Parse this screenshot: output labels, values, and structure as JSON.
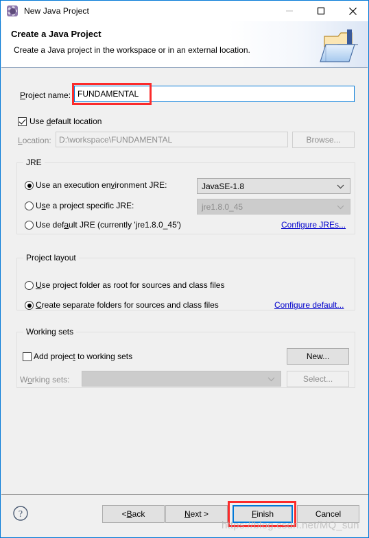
{
  "window": {
    "title": "New Java Project",
    "icon": "java-project-gear-icon",
    "controls": {
      "minimize": "minimize-icon",
      "maximize": "maximize-icon",
      "close": "close-icon"
    },
    "border_color": "#0078d7"
  },
  "header": {
    "title": "Create a Java Project",
    "subtitle": "Create a Java project in the workspace or in an external location.",
    "icon": "java-folder-icon"
  },
  "form": {
    "project_name_label": "Project name:",
    "project_name_value": "FUNDAMENTAL",
    "use_default_location_label": "Use default location",
    "use_default_location_checked": true,
    "location_label": "Location:",
    "location_value": "D:\\workspace\\FUNDAMENTAL",
    "browse_label": "Browse...",
    "browse_enabled": false
  },
  "jre": {
    "group_title": "JRE",
    "option_execution_env": "Use an execution environment JRE:",
    "option_execution_env_selected": true,
    "execution_env_value": "JavaSE-1.8",
    "option_project_specific": "Use a project specific JRE:",
    "option_project_specific_selected": false,
    "project_specific_value": "jre1.8.0_45",
    "option_default_jre": "Use default JRE (currently 'jre1.8.0_45')",
    "option_default_jre_selected": false,
    "configure_link": "Configure JREs..."
  },
  "project_layout": {
    "group_title": "Project layout",
    "option_root": "Use project folder as root for sources and class files",
    "option_root_selected": false,
    "option_separate": "Create separate folders for sources and class files",
    "option_separate_selected": true,
    "configure_link": "Configure default..."
  },
  "working_sets": {
    "group_title": "Working sets",
    "add_project_label": "Add project to working sets",
    "add_project_checked": false,
    "new_label": "New...",
    "working_sets_label": "Working sets:",
    "working_sets_value": "",
    "select_label": "Select...",
    "select_enabled": false
  },
  "footer": {
    "help_icon": "help-icon",
    "back_label": "< Back",
    "next_label": "Next >",
    "finish_label": "Finish",
    "cancel_label": "Cancel"
  },
  "annotations": {
    "highlight_color": "#fb2b2b",
    "targets": [
      "project-name-input",
      "finish-button"
    ]
  },
  "watermark": {
    "text": "https://blog.csdn.net/MQ_sun"
  }
}
